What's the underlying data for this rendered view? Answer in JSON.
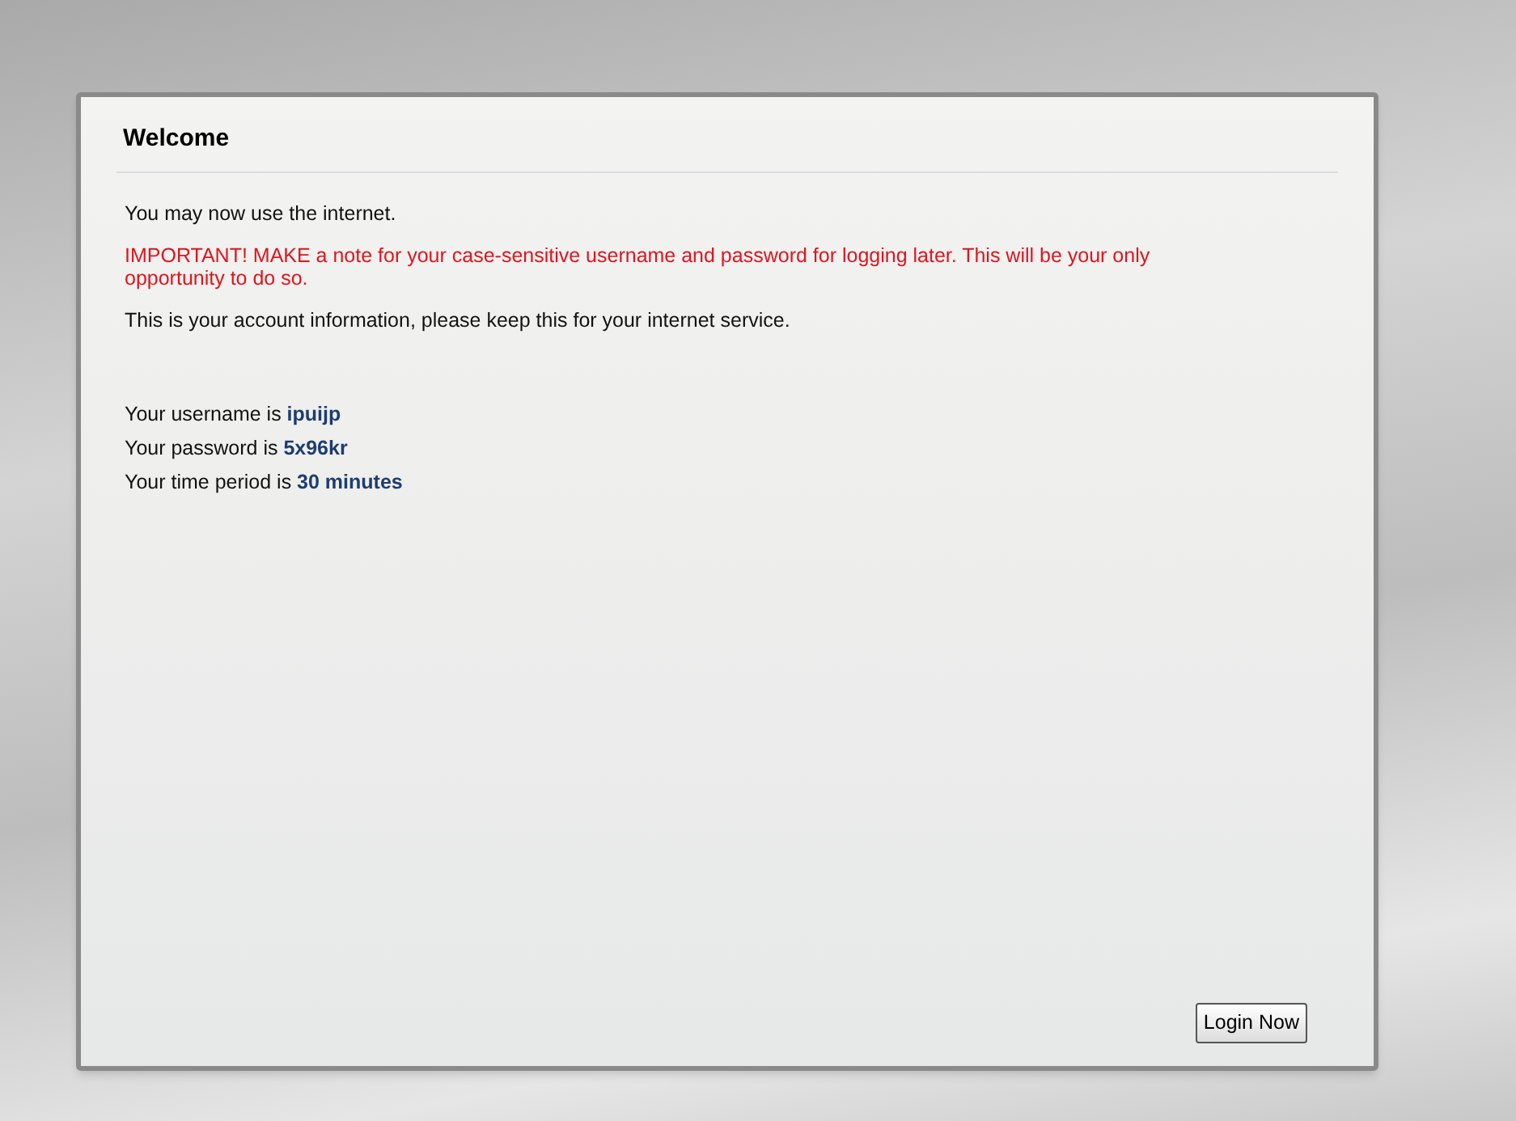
{
  "panel": {
    "title": "Welcome"
  },
  "messages": [
    {
      "kind": "normal",
      "text": "You may now use the internet."
    },
    {
      "kind": "warning",
      "text": "IMPORTANT! MAKE a note for your case-sensitive username and password for logging later. This will be your only opportunity to do so."
    },
    {
      "kind": "normal",
      "text": "This is your account information, please keep this for your internet service."
    }
  ],
  "account_lines": [
    "Your username is **ipuijp**",
    "Your password is **5x96kr**",
    "Your time period is **30 minutes**"
  ],
  "button": {
    "label": "Login Now"
  }
}
